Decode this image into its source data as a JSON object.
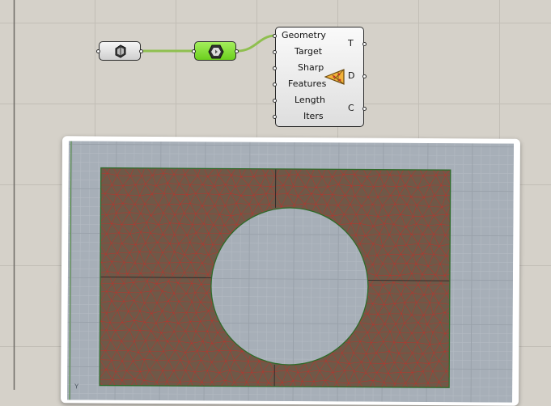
{
  "canvas": {
    "background": "#d5d1c9",
    "grid_color": "#c2beb6",
    "wire_color": "#8fbf4f"
  },
  "nodes": {
    "brep_param": {
      "icon": "brep-icon"
    },
    "mesh_param": {
      "icon": "mesh-icon",
      "fill": "#7ee02a"
    },
    "remesher": {
      "inputs": [
        "Geometry",
        "Target",
        "Sharp",
        "Features",
        "Length",
        "Iters"
      ],
      "outputs": [
        "T",
        "D",
        "C"
      ],
      "icon": "remesh-icon"
    }
  },
  "viewport": {
    "background": "#a7afb8",
    "mesh_fill": "#6f5948",
    "mesh_edge": "#c0312b",
    "boundary": "#2f6b2a",
    "axis_label": "Y"
  }
}
